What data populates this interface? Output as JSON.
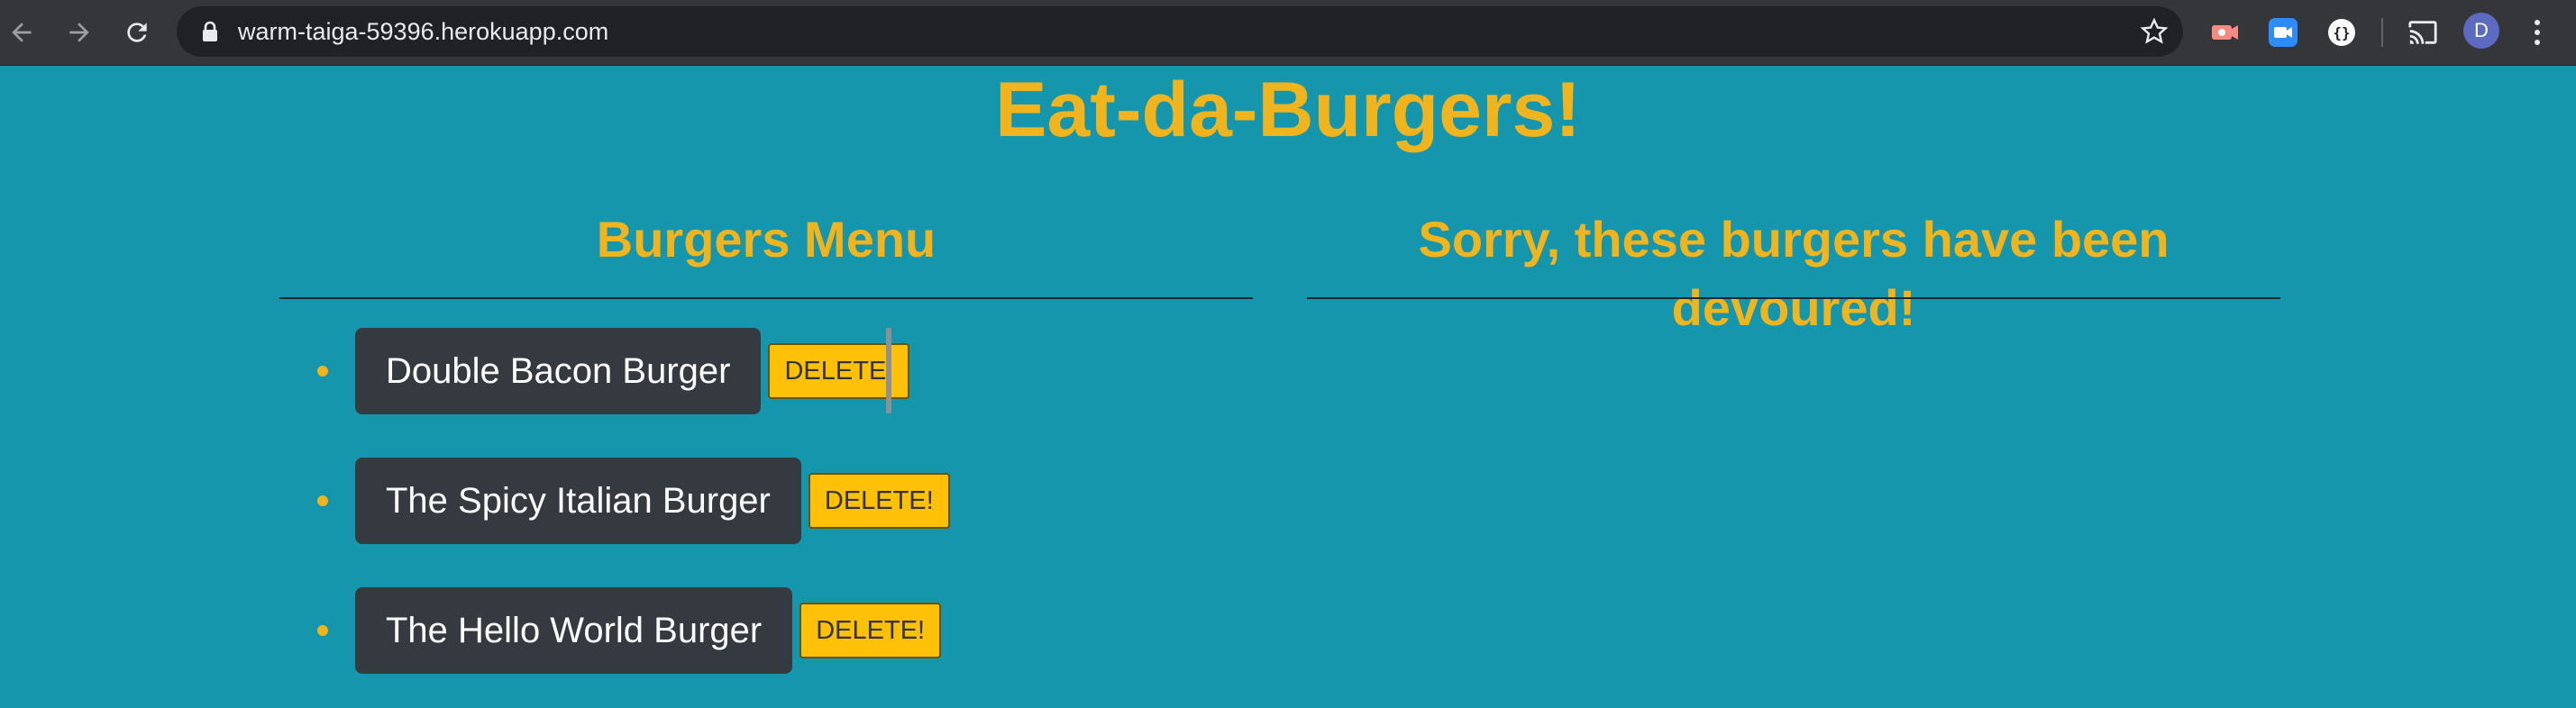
{
  "browser": {
    "url": "warm-taiga-59396.herokuapp.com",
    "avatar_initial": "D"
  },
  "page": {
    "title": "Eat-da-Burgers!",
    "menu_heading": "Burgers Menu",
    "devoured_heading": "Sorry, these burgers have been devoured!"
  },
  "burgers": [
    {
      "name": "Double Bacon Burger",
      "button": "DELETE!"
    },
    {
      "name": "The Spicy Italian Burger",
      "button": "DELETE!"
    },
    {
      "name": "The Hello World Burger",
      "button": "DELETE!"
    }
  ],
  "colors": {
    "background": "#1596ad",
    "accent": "#f0b41e",
    "card": "#343a40",
    "button": "#ffc107"
  }
}
